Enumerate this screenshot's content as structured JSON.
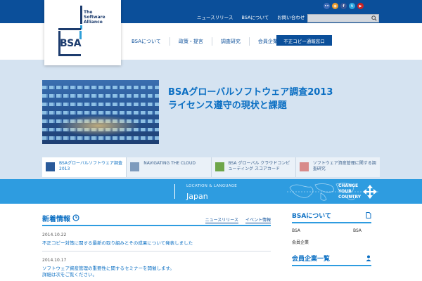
{
  "topnav": {
    "items": [
      "ニュースリリース",
      "BSAについて",
      "お問い合わせ"
    ]
  },
  "search": {
    "placeholder": ""
  },
  "social": [
    {
      "icon": "flickr-icon",
      "glyph": "••",
      "color": "#3f6cb7"
    },
    {
      "icon": "rss-icon",
      "glyph": "◉",
      "color": "#e89b2c"
    },
    {
      "icon": "facebook-icon",
      "glyph": "f",
      "color": "#3b5998"
    },
    {
      "icon": "twitter-icon",
      "glyph": "t",
      "color": "#2ea8df"
    },
    {
      "icon": "youtube-icon",
      "glyph": "▶",
      "color": "#cc2222"
    }
  ],
  "logo": {
    "tsa_line1": "The",
    "tsa_line2": "Software",
    "tsa_line3": "Alliance",
    "bsa": "BSA"
  },
  "mainnav": {
    "items": [
      "BSAについて",
      "政策・提言",
      "調査研究",
      "会員企業 & パートナー"
    ],
    "cta": "不正コピー通報窓口"
  },
  "hero": {
    "title_line1": "BSAグローバルソフトウェア調査2013",
    "title_line2": "ライセンス遵守の現状と課題"
  },
  "cards": [
    {
      "label": "BSAグローバルソフトウェア調査2013",
      "active": true,
      "thumb_color": "#2a5a9a"
    },
    {
      "label": "NAVIGATING THE CLOUD",
      "active": false,
      "thumb_color": "#7e9bbd"
    },
    {
      "label": "BSA グローバル クラウドコンピューティング スコアカード",
      "active": false,
      "thumb_color": "#6ea64a"
    },
    {
      "label": "ソフトウェア資産管理に関する調査研究",
      "active": false,
      "thumb_color": "#d88b8b"
    }
  ],
  "location": {
    "label": "LOCATION & LANGUAGE",
    "country": "Japan",
    "change_line1": "CHANGE",
    "change_line2": "YOUR",
    "change_line3": "COUNTRY"
  },
  "news": {
    "title": "新着情報",
    "tabs": [
      "ニュースリリース",
      "イベント情報"
    ],
    "items": [
      {
        "date": "2014.10.22",
        "text": "不正コピー対策に関する最新の取り組みとその成果について発表しました"
      },
      {
        "date": "2014.10.17",
        "text": "ソフトウェア資産管理の重要性に関するセミナーを開催します。",
        "text2": "詳細は次をご覧ください。"
      }
    ]
  },
  "side": {
    "title1": "BSAについて",
    "row1_left": "BSA",
    "row1_right": "BSA",
    "row2": "会員企業",
    "title2": "会員企業一覧"
  },
  "colors": {
    "brand_navy": "#0b4f9a",
    "accent_blue": "#2e9ce0",
    "link_blue": "#0b6fc3"
  }
}
